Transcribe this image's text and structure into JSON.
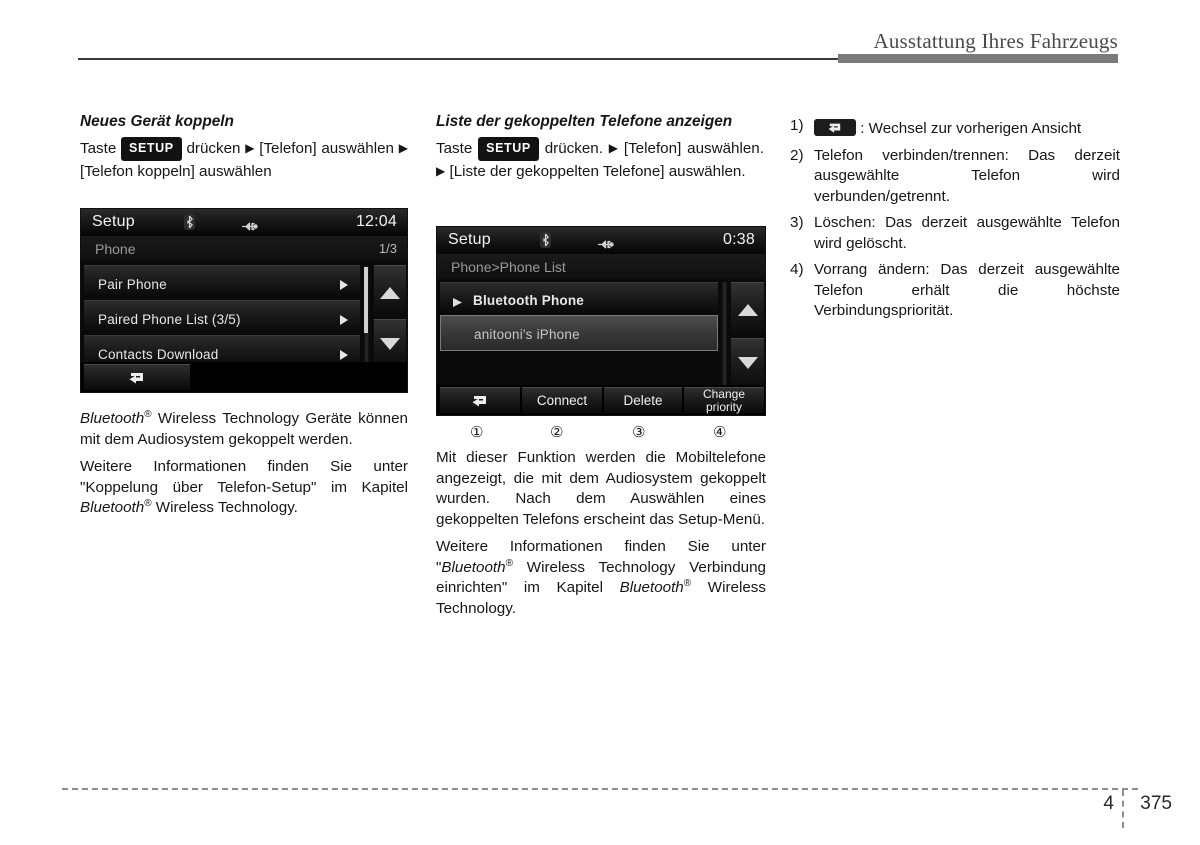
{
  "header": {
    "title": "Ausstattung Ihres Fahrzeugs"
  },
  "footer": {
    "chapter": "4",
    "page": "375"
  },
  "columns": {
    "left": {
      "section_title": "Neues Gerät koppeln",
      "instruction": {
        "pre": "Taste",
        "key": "SETUP",
        "mid": "drücken",
        "arrow": "▶",
        "step1": "[Telefon] auswählen",
        "arrow2": "▶",
        "step2": "[Telefon koppeln] auswählen"
      },
      "paragraphs": [
        {
          "parts": [
            {
              "text": "Bluetooth",
              "style": "italic"
            },
            {
              "text": "®",
              "style": "sup"
            },
            {
              "text": " Wireless Technology Geräte können mit dem Audiosystem gekoppelt werden.",
              "style": "normal"
            }
          ]
        },
        {
          "parts": [
            {
              "text": "Weitere Informationen finden Sie unter \"Koppelung über Telefon-Setup\" im Kapitel ",
              "style": "normal"
            },
            {
              "text": "Bluetooth",
              "style": "italic"
            },
            {
              "text": "®",
              "style": "sup"
            },
            {
              "text": " Wireless Technology.",
              "style": "normal"
            }
          ]
        }
      ],
      "screenshot": {
        "status": {
          "title": "Setup",
          "clock": "12:04",
          "bluetooth_icon": "bluetooth-icon",
          "usb_icon": "usb-icon"
        },
        "subheader": {
          "breadcrumb": "Phone",
          "page_indicator": "1/3"
        },
        "rows": [
          {
            "label": "Pair Phone",
            "arrow_icon": "chevron-right-icon",
            "selected": false
          },
          {
            "label": "Paired Phone List (3/5)",
            "arrow_icon": "chevron-right-icon",
            "selected": false
          },
          {
            "label": "Contacts Download",
            "arrow_icon": "chevron-right-icon",
            "selected": false
          }
        ],
        "scroll": {
          "up_icon": "scroll-up-icon",
          "down_icon": "scroll-down-icon"
        },
        "softkeys": [
          {
            "label": "",
            "icon": "back-icon"
          }
        ]
      }
    },
    "middle": {
      "section_title": "Liste der gekoppelten Telefone anzeigen",
      "instruction": {
        "pre": "Taste",
        "key": "SETUP",
        "mid": "drücken.",
        "arrow": "▶",
        "step1": "[Telefon] auswählen.",
        "arrow2": "▶",
        "step2": "[Liste der gekoppelten Telefone] auswählen."
      },
      "screenshot": {
        "status": {
          "title": "Setup",
          "clock": "0:38",
          "bluetooth_icon": "bluetooth-icon",
          "usb_icon": "usb-icon"
        },
        "subheader": {
          "breadcrumb": "Phone>Phone List",
          "page_indicator": ""
        },
        "rows": [
          {
            "label": "Bluetooth Phone",
            "lead_icon": "triangle-right-icon",
            "selected": false
          },
          {
            "label": "anitooni's iPhone",
            "lead_icon": "",
            "selected": true
          }
        ],
        "scroll": {
          "up_icon": "scroll-up-icon",
          "down_icon": "scroll-down-icon"
        },
        "softkeys": [
          {
            "label": "",
            "icon": "back-icon"
          },
          {
            "label": "Connect",
            "icon": ""
          },
          {
            "label": "Delete",
            "icon": ""
          },
          {
            "label": "Change\npriority",
            "icon": ""
          }
        ],
        "callouts": [
          "①",
          "②",
          "③",
          "④"
        ]
      },
      "paragraphs": [
        {
          "parts": [
            {
              "text": "Mit dieser Funktion werden die Mobiltelefone angezeigt, die mit dem Audiosystem gekoppelt wurden. Nach dem Auswählen eines gekoppelten Telefons erscheint das Setup-Menü.",
              "style": "normal"
            }
          ]
        },
        {
          "parts": [
            {
              "text": "Weitere Informationen finden Sie unter \"",
              "style": "normal"
            },
            {
              "text": "Bluetooth",
              "style": "italic"
            },
            {
              "text": "®",
              "style": "sup"
            },
            {
              "text": " Wireless Technology Verbindung einrichten\" im Kapitel ",
              "style": "normal"
            },
            {
              "text": "Bluetooth",
              "style": "italic"
            },
            {
              "text": "®",
              "style": "sup"
            },
            {
              "text": " Wireless Technology.",
              "style": "normal"
            }
          ]
        }
      ]
    },
    "right": {
      "items": [
        {
          "marker": "1)",
          "icon": "back-key-icon",
          "text": ": Wechsel zur vorherigen Ansicht"
        },
        {
          "marker": "2)",
          "icon": "",
          "text": "Telefon verbinden/trennen: Das derzeit ausgewählte Telefon wird verbunden/getrennt."
        },
        {
          "marker": "3)",
          "icon": "",
          "text": "Löschen: Das derzeit ausgewählte Telefon wird gelöscht."
        },
        {
          "marker": "4)",
          "icon": "",
          "text": "Vorrang ändern: Das derzeit ausgewählte Telefon erhält die höchste Verbindungspriorität."
        }
      ]
    }
  },
  "colors": {
    "header_bar": "#7a7a7a",
    "header_rule": "#3c3c3c",
    "text": "#161616",
    "screen_bg": "#0a0a0a",
    "screen_text": "#e8e8e8",
    "selected_row": "#4e4e4e"
  }
}
